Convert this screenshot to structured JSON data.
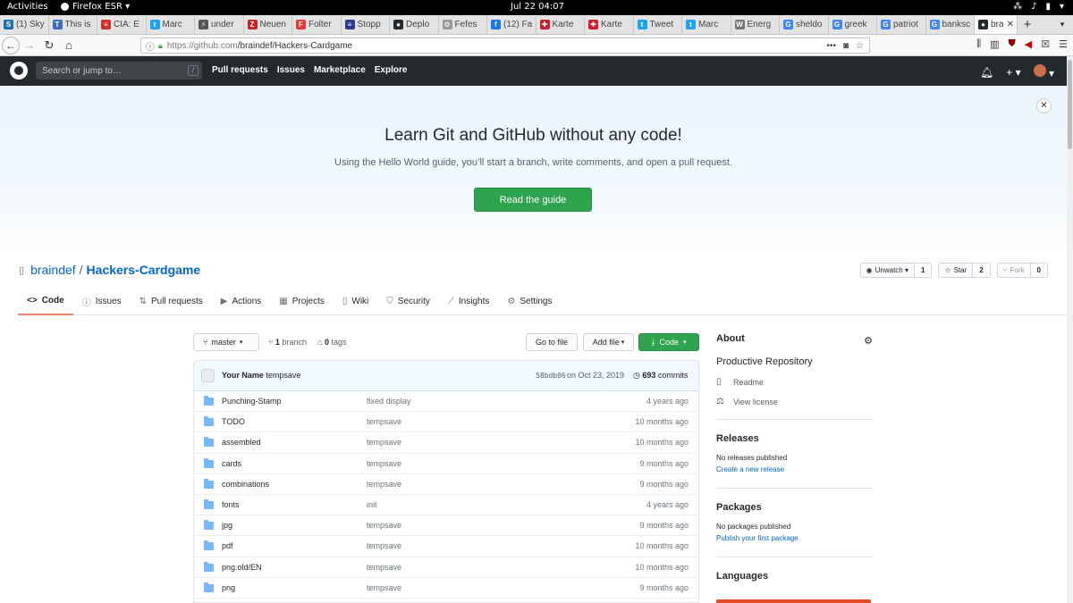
{
  "topbar": {
    "activities": "Activities",
    "app": "Firefox ESR ▾",
    "clock": "Jul 22  04:07"
  },
  "tabs": [
    {
      "label": "(1) Sky",
      "color": "#1d6fb8",
      "glyph": "S"
    },
    {
      "label": "This is",
      "color": "#3d6dbb",
      "glyph": "T"
    },
    {
      "label": "CIA: E",
      "color": "#d32f2f",
      "glyph": "≡"
    },
    {
      "label": "Marc",
      "color": "#1da1f2",
      "glyph": "t"
    },
    {
      "label": "under",
      "color": "#555555",
      "glyph": "⚡"
    },
    {
      "label": "Neuen",
      "color": "#cc2222",
      "glyph": "Z"
    },
    {
      "label": "Folter",
      "color": "#e53935",
      "glyph": "F"
    },
    {
      "label": "Stopp",
      "color": "#2b3a8c",
      "glyph": "≡"
    },
    {
      "label": "Deplo",
      "color": "#24292e",
      "glyph": "●"
    },
    {
      "label": "Fefes",
      "color": "#999999",
      "glyph": "⚙"
    },
    {
      "label": "(12) Fa",
      "color": "#1877f2",
      "glyph": "f"
    },
    {
      "label": "Karte",
      "color": "#cc1f2f",
      "glyph": "✚"
    },
    {
      "label": "Karte",
      "color": "#cc1f2f",
      "glyph": "✚"
    },
    {
      "label": "Tweet",
      "color": "#1da1f2",
      "glyph": "t"
    },
    {
      "label": "Marc",
      "color": "#1da1f2",
      "glyph": "t"
    },
    {
      "label": "Energ",
      "color": "#777777",
      "glyph": "W"
    },
    {
      "label": "sheldo",
      "color": "#4285f4",
      "glyph": "G"
    },
    {
      "label": "greek",
      "color": "#4285f4",
      "glyph": "G"
    },
    {
      "label": "patriot",
      "color": "#4285f4",
      "glyph": "G"
    },
    {
      "label": "banksc",
      "color": "#4285f4",
      "glyph": "G"
    },
    {
      "label": "bra",
      "color": "#24292e",
      "glyph": "●",
      "active": true
    }
  ],
  "navbar": {
    "url_host": "https://github.com",
    "url_path": "/braindef/Hackers-Cardgame"
  },
  "github": {
    "search_placeholder": "Search or jump to…",
    "nav": [
      "Pull requests",
      "Issues",
      "Marketplace",
      "Explore"
    ]
  },
  "hero": {
    "title": "Learn Git and GitHub without any code!",
    "subtitle": "Using the Hello World guide, you’ll start a branch, write comments, and open a pull request.",
    "cta": "Read the guide"
  },
  "repo": {
    "owner": "braindef",
    "name": "Hackers-Cardgame",
    "watch_label": "Unwatch ▾",
    "watch_count": "1",
    "star_label": "Star",
    "star_count": "2",
    "fork_label": "Fork",
    "fork_count": "0",
    "tabs": [
      {
        "icon": "<>",
        "label": "Code",
        "active": true
      },
      {
        "icon": "ⓘ",
        "label": "Issues"
      },
      {
        "icon": "⇅",
        "label": "Pull requests"
      },
      {
        "icon": "▶",
        "label": "Actions"
      },
      {
        "icon": "▦",
        "label": "Projects"
      },
      {
        "icon": "▯",
        "label": "Wiki"
      },
      {
        "icon": "⛉",
        "label": "Security"
      },
      {
        "icon": "⟋",
        "label": "Insights"
      },
      {
        "icon": "⚙",
        "label": "Settings"
      }
    ]
  },
  "files": {
    "branch": "master",
    "branch_count": "1",
    "branch_word": "branch",
    "tag_count": "0",
    "tag_word": "tags",
    "goto": "Go to file",
    "add": "Add file",
    "code": "Code",
    "commit": {
      "author": "Your Name",
      "message": "tempsave",
      "sha": "58bdb06",
      "date": "on Oct 23, 2019",
      "count": "693",
      "count_word": "commits"
    },
    "rows": [
      {
        "name": "Punching-Stamp",
        "msg": "fixed display",
        "age": "4 years ago"
      },
      {
        "name": "TODO",
        "msg": "tempsave",
        "age": "10 months ago"
      },
      {
        "name": "assembled",
        "msg": "tempsave",
        "age": "10 months ago"
      },
      {
        "name": "cards",
        "msg": "tempsave",
        "age": "9 months ago"
      },
      {
        "name": "combinations",
        "msg": "tempsave",
        "age": "9 months ago"
      },
      {
        "name": "fonts",
        "msg": "init",
        "age": "4 years ago"
      },
      {
        "name": "jpg",
        "msg": "tempsave",
        "age": "9 months ago"
      },
      {
        "name": "pdf",
        "msg": "tempsave",
        "age": "10 months ago"
      },
      {
        "name": "png.old/EN",
        "msg": "tempsave",
        "age": "10 months ago"
      },
      {
        "name": "png",
        "msg": "tempsave",
        "age": "9 months ago"
      }
    ]
  },
  "sidebar": {
    "about": "About",
    "description": "Productive Repository",
    "readme": "Readme",
    "license": "View license",
    "releases": "Releases",
    "no_releases": "No releases published",
    "create_release": "Create a new release",
    "packages": "Packages",
    "no_packages": "No packages published",
    "publish_package": "Publish your first package",
    "languages": "Languages"
  }
}
